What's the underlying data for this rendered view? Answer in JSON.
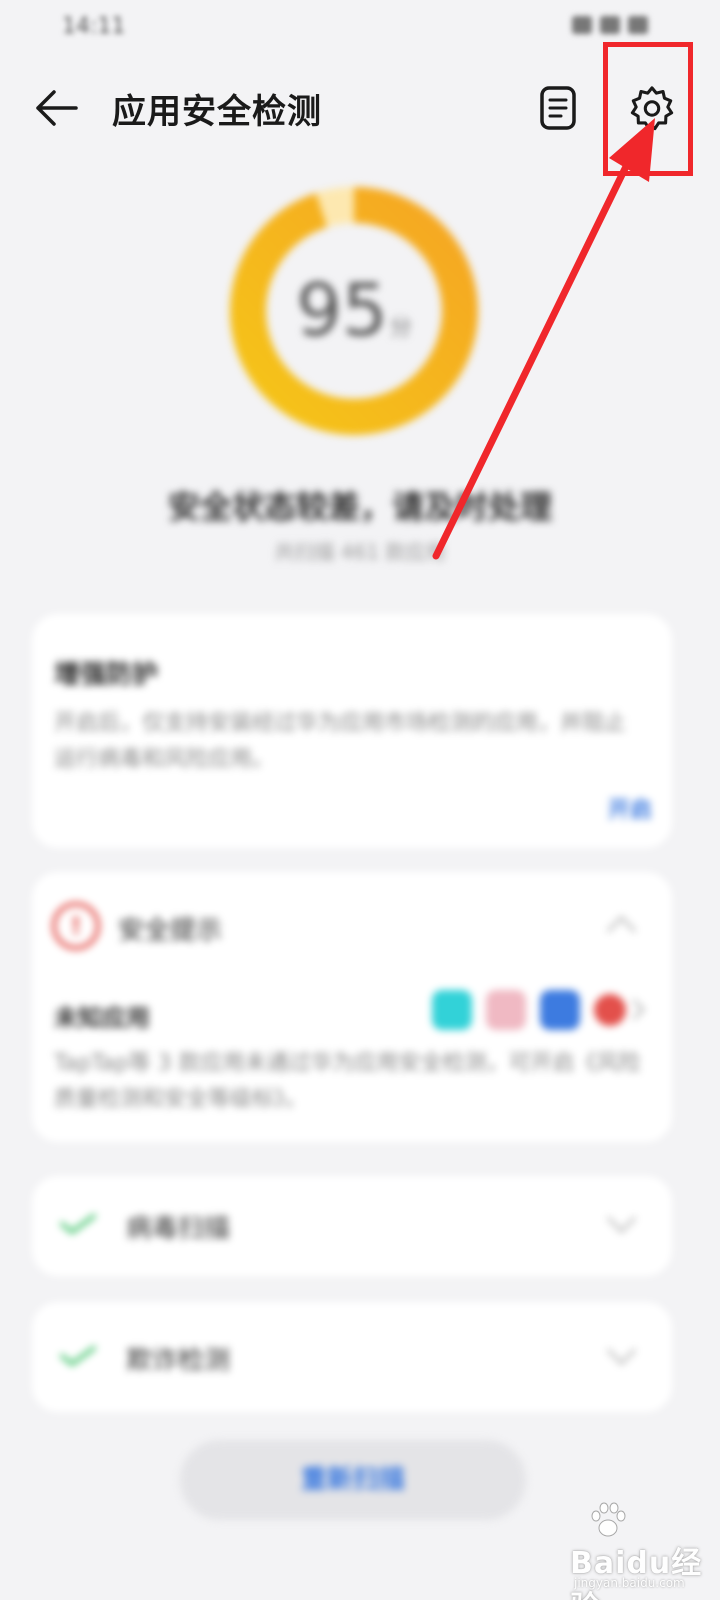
{
  "status_bar": {
    "time": "14:11"
  },
  "header": {
    "title": "应用安全检测",
    "back_icon": "back-arrow-icon",
    "report_icon": "document-icon",
    "settings_icon": "gear-icon"
  },
  "score": {
    "value": "95",
    "unit": "分",
    "level": 0.95,
    "colors": {
      "start": "#f5a623",
      "end": "#f5c518"
    }
  },
  "summary": {
    "status": "安全状态较差，请及时处理",
    "detail": "共扫描 461 款应用"
  },
  "protection_card": {
    "title": "增强防护",
    "description": "开启后，仅支持安装经过华为应用市场检测的应用，并阻止运行病毒和风险应用。",
    "action": "开启"
  },
  "tips_card": {
    "title": "安全提示",
    "row_title": "未知应用",
    "description": "TapTap等 3 款应用未通过华为应用安全检测，可开启《风险质量检测和安全等级标》。"
  },
  "checks": [
    {
      "label": "病毒扫描"
    },
    {
      "label": "欺诈检测"
    }
  ],
  "footer": {
    "rescan": "重新扫描"
  },
  "annotation": {
    "color": "#f0272b"
  },
  "watermark": {
    "text": "Baidu经验",
    "sub": "jingyan.baidu.com"
  }
}
